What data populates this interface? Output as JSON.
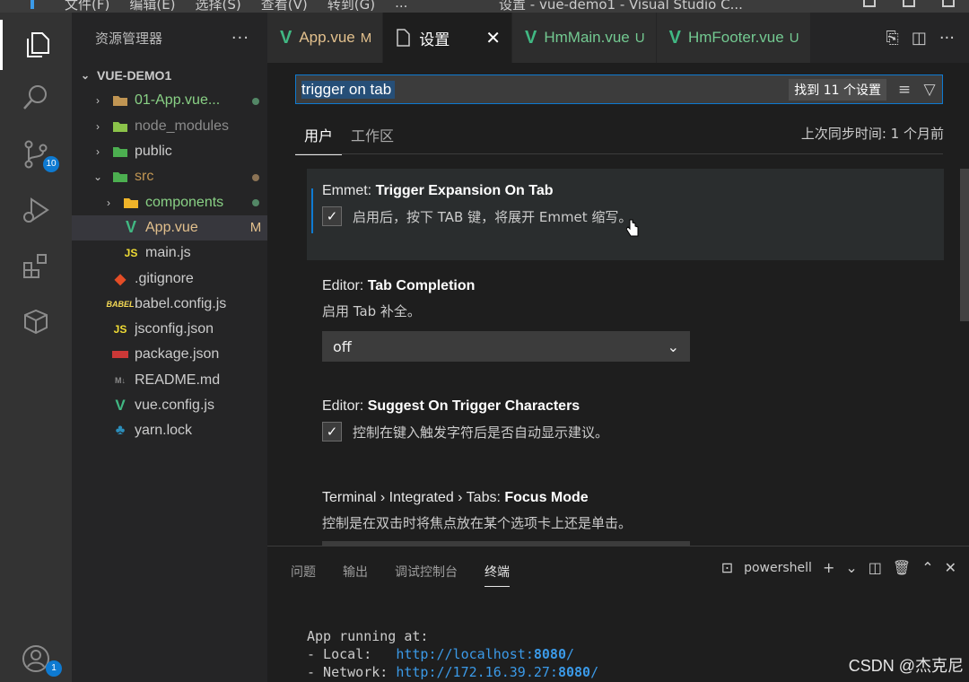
{
  "window": {
    "title": "设置 - vue-demo1 - Visual Studio C...",
    "menu": [
      "文件(F)",
      "编辑(E)",
      "选择(S)",
      "查看(V)",
      "转到(G)",
      "..."
    ]
  },
  "activity_bar": {
    "items": [
      {
        "icon": "files-icon",
        "active": true
      },
      {
        "icon": "search-icon"
      },
      {
        "icon": "source-control-icon",
        "badge": "10"
      },
      {
        "icon": "run-debug-icon"
      },
      {
        "icon": "extensions-icon"
      },
      {
        "icon": "package-icon"
      }
    ],
    "account_badge": "1"
  },
  "sidebar": {
    "title": "资源管理器",
    "more": "···",
    "project": "VUE-DEMO1",
    "items": [
      {
        "name": "01-App.vue...",
        "type": "folder",
        "status": "dot",
        "color": "#89d185",
        "level": 1
      },
      {
        "name": "node_modules",
        "type": "folder-node",
        "status": "",
        "color": "#8b8b8b",
        "level": 1
      },
      {
        "name": "public",
        "type": "folder-public",
        "status": "",
        "color": "#cccccc",
        "level": 1
      },
      {
        "name": "src",
        "type": "folder-src",
        "status": "dot",
        "color": "#c09553",
        "level": 1,
        "open": true
      },
      {
        "name": "components",
        "type": "folder-components",
        "status": "dot",
        "color": "#89d185",
        "level": 2
      },
      {
        "name": "App.vue",
        "type": "vue",
        "status": "M",
        "color": "#e2c08d",
        "level": 2
      },
      {
        "name": "main.js",
        "type": "js",
        "status": "",
        "color": "#cccccc",
        "level": 2
      },
      {
        "name": ".gitignore",
        "type": "git",
        "status": "",
        "color": "#cccccc",
        "level": 1
      },
      {
        "name": "babel.config.js",
        "type": "babel",
        "status": "",
        "color": "#cccccc",
        "level": 1
      },
      {
        "name": "jsconfig.json",
        "type": "jsjson",
        "status": "",
        "color": "#cccccc",
        "level": 1
      },
      {
        "name": "package.json",
        "type": "npm",
        "status": "",
        "color": "#cccccc",
        "level": 1
      },
      {
        "name": "README.md",
        "type": "md",
        "status": "",
        "color": "#cccccc",
        "level": 1
      },
      {
        "name": "vue.config.js",
        "type": "vuecfg",
        "status": "",
        "color": "#cccccc",
        "level": 1
      },
      {
        "name": "yarn.lock",
        "type": "yarn",
        "status": "",
        "color": "#cccccc",
        "level": 1
      }
    ]
  },
  "tabs": [
    {
      "label": "App.vue",
      "status": "M",
      "icon": "vue-icon",
      "color": "#e2c08d"
    },
    {
      "label": "设置",
      "status": "",
      "icon": "settings-file-icon",
      "active": true,
      "close": "✕"
    },
    {
      "label": "HmMain.vue",
      "status": "U",
      "icon": "vue-icon",
      "color": "#73c991"
    },
    {
      "label": "HmFooter.vue",
      "status": "U",
      "icon": "vue-icon",
      "color": "#73c991"
    }
  ],
  "settings": {
    "search_value": "trigger on tab",
    "result_count": "找到 11 个设置",
    "scope_tabs": [
      "用户",
      "工作区"
    ],
    "sync_info": "上次同步时间: 1 个月前",
    "items": [
      {
        "category": "Emmet: ",
        "name": "Trigger Expansion On Tab",
        "description": "启用后，按下 TAB 键，将展开 Emmet 缩写。",
        "control": "checkbox",
        "checked": true
      },
      {
        "category": "Editor: ",
        "name": "Tab Completion",
        "description": "启用 Tab 补全。",
        "control": "select",
        "value": "off"
      },
      {
        "category": "Editor: ",
        "name": "Suggest On Trigger Characters",
        "description": "控制在键入触发字符后是否自动显示建议。",
        "control": "checkbox",
        "checked": true
      },
      {
        "category": "Terminal › Integrated › Tabs: ",
        "name": "Focus Mode",
        "description": "控制是在双击时将焦点放在某个选项卡上还是单击。",
        "control": "select",
        "value": ""
      }
    ]
  },
  "panel": {
    "tabs": [
      "问题",
      "输出",
      "调试控制台",
      "终端"
    ],
    "active_tab": "终端",
    "shell": "powershell",
    "terminal": {
      "line1": "App running at:",
      "local_label": "- Local:   ",
      "local_url": "http://localhost:",
      "local_port": "8080",
      "local_tail": "/",
      "network_label": "- Network: ",
      "network_url": "http://172.16.39.27:",
      "network_port": "8080",
      "network_tail": "/"
    }
  },
  "watermark": "CSDN @杰克尼"
}
